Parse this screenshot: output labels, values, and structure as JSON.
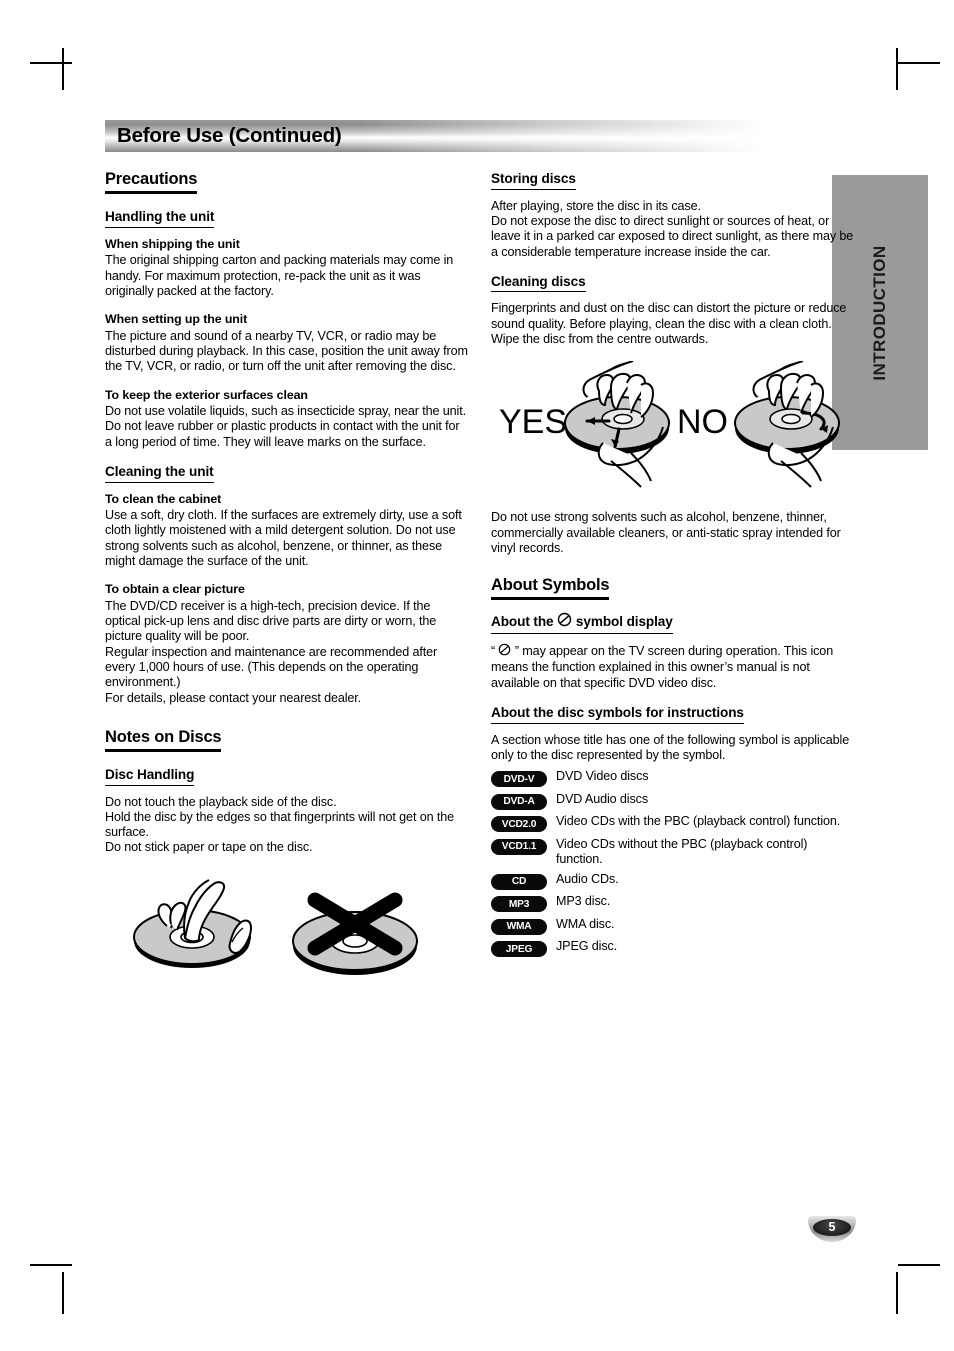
{
  "header": {
    "title": "Before Use (Continued)"
  },
  "sidebar": {
    "tab_label": "INTRODUCTION"
  },
  "footer": {
    "page_number": "5"
  },
  "left_column": {
    "precautions": {
      "heading": "Precautions",
      "handling": {
        "heading": "Handling the unit",
        "shipping": {
          "title": "When shipping the unit",
          "text": "The original shipping carton and packing materials may come in handy. For maximum protection, re-pack the unit as it was originally packed at the factory."
        },
        "setting_up": {
          "title": "When setting up the unit",
          "text": "The picture and sound of a nearby TV, VCR, or radio may be disturbed during playback. In this case, position the unit away from the TV, VCR, or radio, or turn off the unit after removing the disc."
        },
        "exterior": {
          "title": "To keep the exterior surfaces clean",
          "text": "Do not use volatile liquids, such as insecticide spray, near the unit. Do not leave rubber or plastic products in contact with the unit for a long period of time. They will leave marks on the surface."
        }
      },
      "cleaning": {
        "heading": "Cleaning the unit",
        "cabinet": {
          "title": "To clean the cabinet",
          "text": "Use a soft, dry cloth. If the surfaces are extremely dirty, use a soft cloth lightly moistened with a mild detergent solution. Do not use strong solvents such as alcohol, benzene, or thinner, as these might damage the surface of the unit."
        },
        "clear_picture": {
          "title": "To obtain a clear picture",
          "text_1": "The DVD/CD receiver is a high-tech, precision device. If the optical pick-up lens and disc drive parts are dirty or worn, the picture quality will be poor.",
          "text_2": "Regular inspection and maintenance are recommended after every 1,000 hours of use. (This depends on the operating environment.)",
          "text_3": "For details, please contact your nearest dealer."
        }
      }
    },
    "notes_on_discs": {
      "heading": "Notes on Discs",
      "disc_handling": {
        "heading": "Disc Handling",
        "line_1": "Do not touch the playback side of the disc.",
        "line_2": "Hold the disc by the edges so that fingerprints will not get on the surface.",
        "line_3": "Do not stick paper or tape on the disc."
      },
      "figure": {
        "name": "disc-handling-illustration",
        "alt_good": "hand-holding-disc-by-edges",
        "alt_bad": "disc-with-cross-mark"
      }
    }
  },
  "right_column": {
    "storing_discs": {
      "heading": "Storing discs",
      "line_1": "After playing, store the disc in its case.",
      "line_2": "Do not expose the disc to direct sunlight or sources of heat, or leave it in a parked car exposed to direct sunlight, as there may be a considerable temperature increase inside the car."
    },
    "cleaning_discs": {
      "heading": "Cleaning discs",
      "text": "Fingerprints and dust on the disc can distort the picture or reduce sound quality. Before playing, clean the disc with a clean cloth. Wipe the disc from the centre outwards.",
      "figure": {
        "name": "disc-wiping-illustration",
        "yes_label": "YES",
        "no_label": "NO"
      },
      "solvent_warning": "Do not use strong solvents such as alcohol, benzene, thinner, commercially available cleaners, or anti-static spray intended for vinyl records."
    },
    "about_symbols": {
      "heading": "About Symbols",
      "symbol_display": {
        "heading_before": "About the",
        "heading_after": "symbol display",
        "text_before": "“",
        "text_after": "” may appear on the TV screen during operation. This icon means the function explained in this owner’s manual is not available on that specific DVD video disc."
      },
      "disc_symbols": {
        "heading": "About the disc symbols for instructions",
        "intro": "A section whose title has one of the following symbol is applicable only to the disc represented by the symbol.",
        "items": [
          {
            "badge": "DVD-V",
            "desc": "DVD Video discs"
          },
          {
            "badge": "DVD-A",
            "desc": "DVD Audio discs"
          },
          {
            "badge": "VCD2.0",
            "desc": "Video CDs with the PBC (playback control) function."
          },
          {
            "badge": "VCD1.1",
            "desc": "Video CDs without the PBC (playback control) function."
          },
          {
            "badge": "CD",
            "desc": "Audio CDs."
          },
          {
            "badge": "MP3",
            "desc": "MP3 disc."
          },
          {
            "badge": "WMA",
            "desc": "WMA disc."
          },
          {
            "badge": "JPEG",
            "desc": "JPEG disc."
          }
        ]
      }
    }
  },
  "colors": {
    "sidebar_gray": "#9a9a9a",
    "badge_black": "#0a0a0a",
    "disc_gray": "#c9c9c9",
    "text_black": "#000000"
  }
}
